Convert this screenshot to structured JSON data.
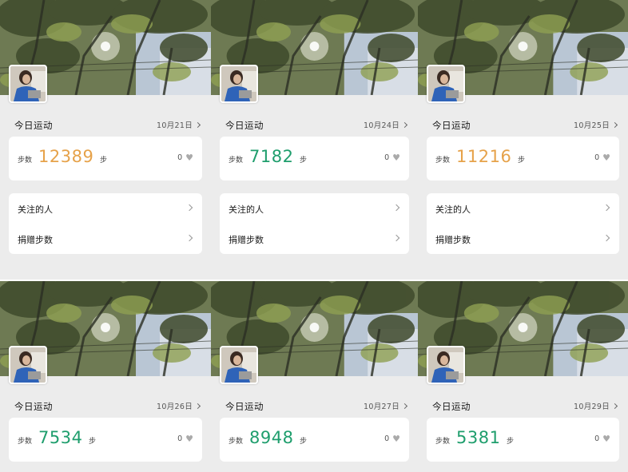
{
  "colors": {
    "orange": "#e6a24a",
    "green": "#1f9e6d",
    "heart": "#aaaaaa"
  },
  "panels": [
    {
      "title": "今日运动",
      "date": "10月21日",
      "steps_label": "步数",
      "steps": "12389",
      "unit": "步",
      "likes": "0",
      "color": "orange",
      "menu": [
        "关注的人",
        "捐赠步数"
      ]
    },
    {
      "title": "今日运动",
      "date": "10月24日",
      "steps_label": "步数",
      "steps": "7182",
      "unit": "步",
      "likes": "0",
      "color": "green",
      "menu": [
        "关注的人",
        "捐赠步数"
      ]
    },
    {
      "title": "今日运动",
      "date": "10月25日",
      "steps_label": "步数",
      "steps": "11216",
      "unit": "步",
      "likes": "0",
      "color": "orange",
      "menu": [
        "关注的人",
        "捐赠步数"
      ]
    },
    {
      "title": "今日运动",
      "date": "10月26日",
      "steps_label": "步数",
      "steps": "7534",
      "unit": "步",
      "likes": "0",
      "color": "green",
      "menu": []
    },
    {
      "title": "今日运动",
      "date": "10月27日",
      "steps_label": "步数",
      "steps": "8948",
      "unit": "步",
      "likes": "0",
      "color": "green",
      "menu": []
    },
    {
      "title": "今日运动",
      "date": "10月29日",
      "steps_label": "步数",
      "steps": "5381",
      "unit": "步",
      "likes": "0",
      "color": "green",
      "menu": []
    }
  ]
}
